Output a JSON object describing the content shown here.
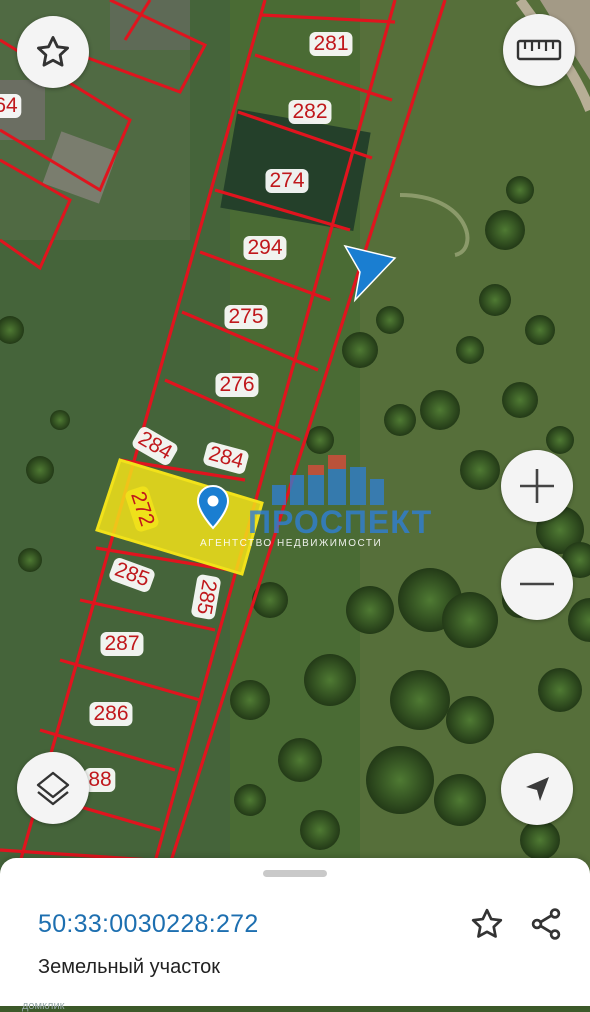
{
  "map": {
    "plots": [
      {
        "id": "plot-281",
        "label": "281"
      },
      {
        "id": "plot-282",
        "label": "282"
      },
      {
        "id": "plot-274",
        "label": "274"
      },
      {
        "id": "plot-294",
        "label": "294"
      },
      {
        "id": "plot-275",
        "label": "275"
      },
      {
        "id": "plot-276",
        "label": "276"
      },
      {
        "id": "plot-284a",
        "label": "284"
      },
      {
        "id": "plot-284b",
        "label": "284"
      },
      {
        "id": "plot-272",
        "label": "272"
      },
      {
        "id": "plot-285a",
        "label": "285"
      },
      {
        "id": "plot-285b",
        "label": "285"
      },
      {
        "id": "plot-287",
        "label": "287"
      },
      {
        "id": "plot-286",
        "label": "286"
      },
      {
        "id": "plot-288",
        "label": "88"
      },
      {
        "id": "plot-264",
        "label": "64"
      }
    ],
    "highlight_color": "#f2e21a",
    "boundary_color": "#e0141e",
    "watermark": {
      "name": "ПРОСПЕКТ",
      "tagline": "АГЕНТСТВО НЕДВИЖИМОСТИ"
    }
  },
  "controls": {
    "favorite_icon": "star-icon",
    "ruler_icon": "ruler-icon",
    "zoom_in_icon": "plus-icon",
    "zoom_out_icon": "minus-icon",
    "layers_icon": "layers-icon",
    "locate_icon": "navigation-arrow-icon"
  },
  "sheet": {
    "cadastral_number": "50:33:0030228:272",
    "object_type": "Земельный участок",
    "brand": "домклик"
  }
}
